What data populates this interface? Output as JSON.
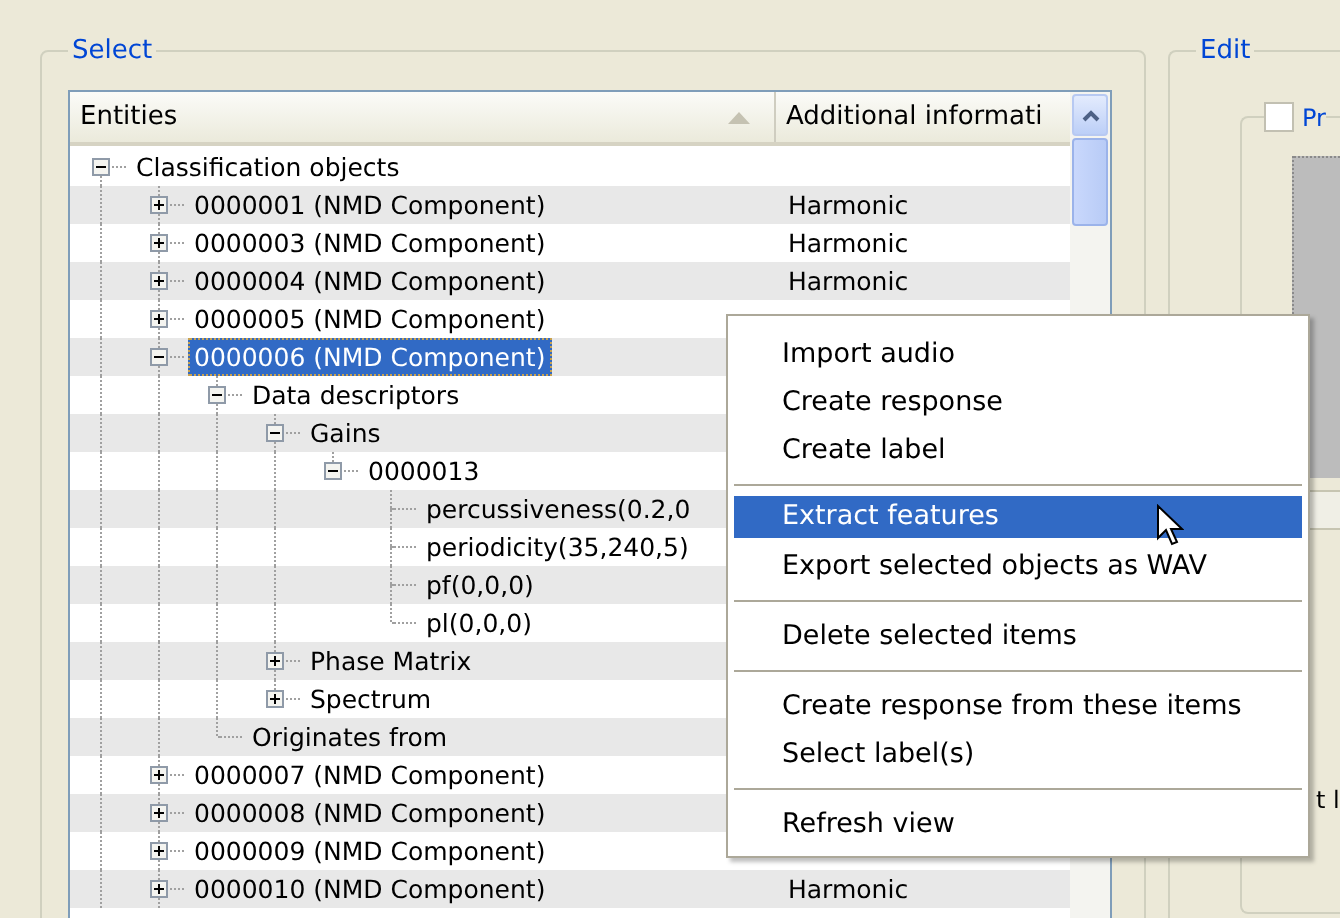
{
  "select_group": {
    "title": "Select"
  },
  "columns": [
    {
      "label": "Entities",
      "sorted": true
    },
    {
      "label": "Additional informati",
      "sorted": false
    }
  ],
  "tree": [
    {
      "label": "Classification objects",
      "expanded": true,
      "selected": false,
      "children": [
        {
          "label": "0000001 (NMD Component)",
          "additional": "Harmonic",
          "expanded": false,
          "selected": false
        },
        {
          "label": "0000003 (NMD Component)",
          "additional": "Harmonic",
          "expanded": false,
          "selected": false
        },
        {
          "label": "0000004 (NMD Component)",
          "additional": "Harmonic",
          "expanded": false,
          "selected": false
        },
        {
          "label": "0000005 (NMD Component)",
          "expanded": false,
          "selected": false
        },
        {
          "label": "0000006 (NMD Component)",
          "expanded": true,
          "selected": true,
          "children": [
            {
              "label": "Data descriptors",
              "expanded": true,
              "selected": false,
              "children": [
                {
                  "label": "Gains",
                  "expanded": true,
                  "selected": false,
                  "children": [
                    {
                      "label": "0000013",
                      "expanded": true,
                      "selected": false,
                      "children": [
                        {
                          "label": "percussiveness(0.2,0",
                          "selected": false
                        },
                        {
                          "label": "periodicity(35,240,5)",
                          "selected": false
                        },
                        {
                          "label": "pf(0,0,0)",
                          "selected": false
                        },
                        {
                          "label": "pl(0,0,0)",
                          "selected": false
                        }
                      ]
                    }
                  ]
                },
                {
                  "label": "Phase Matrix",
                  "expanded": false,
                  "selected": false
                },
                {
                  "label": "Spectrum",
                  "expanded": false,
                  "selected": false
                }
              ]
            },
            {
              "label": "Originates from",
              "selected": false
            }
          ]
        },
        {
          "label": "0000007 (NMD Component)",
          "expanded": false,
          "selected": false
        },
        {
          "label": "0000008 (NMD Component)",
          "expanded": false,
          "selected": false
        },
        {
          "label": "0000009 (NMD Component)",
          "expanded": false,
          "selected": false
        },
        {
          "label": "0000010 (NMD Component)",
          "additional": "Harmonic",
          "expanded": false,
          "selected": false
        }
      ]
    }
  ],
  "context_menu": [
    {
      "kind": "item",
      "label": "Import audio",
      "selected": false
    },
    {
      "kind": "item",
      "label": "Create response",
      "selected": false
    },
    {
      "kind": "item",
      "label": "Create label",
      "selected": false
    },
    {
      "kind": "separator"
    },
    {
      "kind": "item",
      "label": "Extract features",
      "selected": true
    },
    {
      "kind": "item",
      "label": "Export selected objects as WAV",
      "selected": false
    },
    {
      "kind": "separator"
    },
    {
      "kind": "item",
      "label": "Delete selected items",
      "selected": false
    },
    {
      "kind": "separator"
    },
    {
      "kind": "item",
      "label": "Create response from these items",
      "selected": false
    },
    {
      "kind": "item",
      "label": "Select label(s)",
      "selected": false
    },
    {
      "kind": "separator"
    },
    {
      "kind": "item",
      "label": "Refresh view",
      "selected": false
    }
  ],
  "edit_group": {
    "title": "Edit",
    "checkbox": {
      "label": "Pr",
      "checked": false
    },
    "partial_text": "t l"
  }
}
